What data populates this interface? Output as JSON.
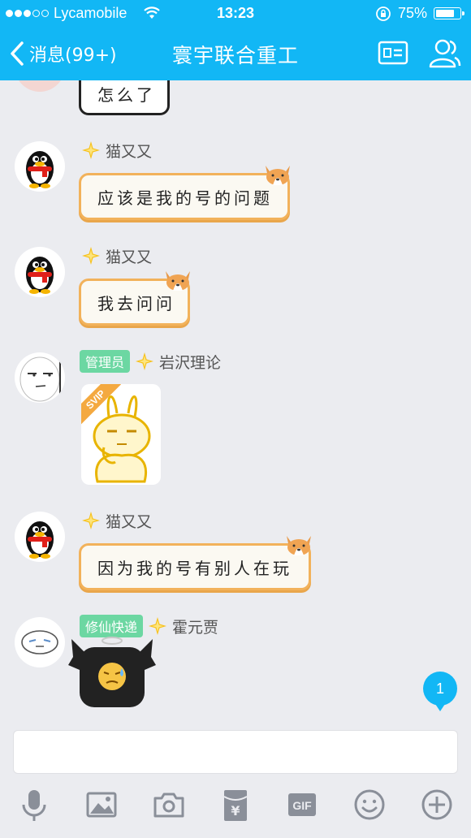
{
  "status_bar": {
    "carrier": "Lycamobile",
    "time": "13:23",
    "battery_percent": "75%",
    "signal_bars_filled": 3,
    "battery_level": 0.75
  },
  "header": {
    "back_label": "消息(99+)",
    "title": "寰宇联合重工"
  },
  "messages": [
    {
      "sender": "",
      "text": "怎么了",
      "type": "text"
    },
    {
      "sender": "猫又又",
      "text": "应该是我的号的问题",
      "type": "text"
    },
    {
      "sender": "猫又又",
      "text": "我去问问",
      "type": "text"
    },
    {
      "sender": "岩沢理论",
      "badge": "管理员",
      "type": "sticker",
      "sticker_tag": "SVIP"
    },
    {
      "sender": "猫又又",
      "text": "因为我的号有别人在玩",
      "type": "text"
    },
    {
      "sender": "霍元贾",
      "badge": "修仙快递",
      "type": "sticker"
    }
  ],
  "unread_count": "1",
  "input": {
    "value": "",
    "placeholder": ""
  },
  "toolbar": {
    "items": [
      "microphone-icon",
      "image-icon",
      "camera-icon",
      "red-packet-icon",
      "gif-icon",
      "emoji-icon",
      "plus-icon"
    ],
    "gif_label": "GIF",
    "red_packet_label": "¥"
  },
  "colors": {
    "header_bg": "#12b7f5",
    "chat_bg": "#ebecf0",
    "badge_bg": "#6cd7a2",
    "bubble_border": "#f2b25b"
  }
}
